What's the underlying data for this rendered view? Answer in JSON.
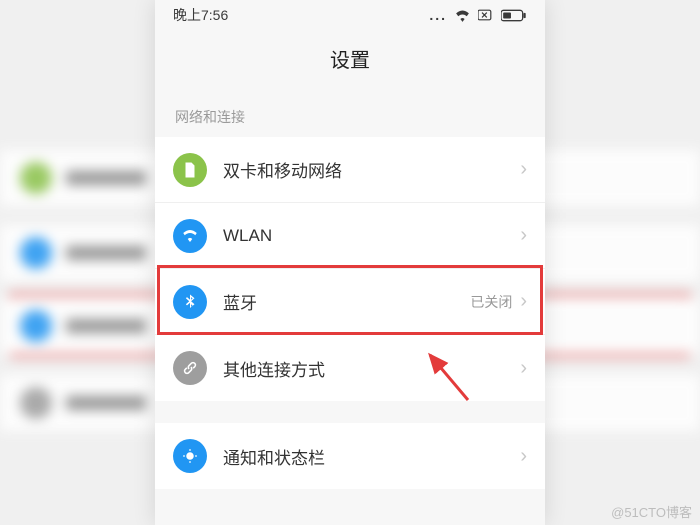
{
  "statusbar": {
    "time": "晚上7:56"
  },
  "header": {
    "title": "设置"
  },
  "section1": {
    "title": "网络和连接",
    "items": [
      {
        "label": "双卡和移动网络",
        "icon": "sim-icon",
        "color": "#8bc34a",
        "status": ""
      },
      {
        "label": "WLAN",
        "icon": "wifi-icon",
        "color": "#2196f3",
        "status": ""
      },
      {
        "label": "蓝牙",
        "icon": "bluetooth-icon",
        "color": "#2196f3",
        "status": "已关闭"
      },
      {
        "label": "其他连接方式",
        "icon": "link-icon",
        "color": "#9e9e9e",
        "status": ""
      }
    ]
  },
  "section2": {
    "items": [
      {
        "label": "通知和状态栏",
        "icon": "notification-icon",
        "color": "#2196f3",
        "status": ""
      }
    ]
  },
  "watermark": "@51CTO博客"
}
